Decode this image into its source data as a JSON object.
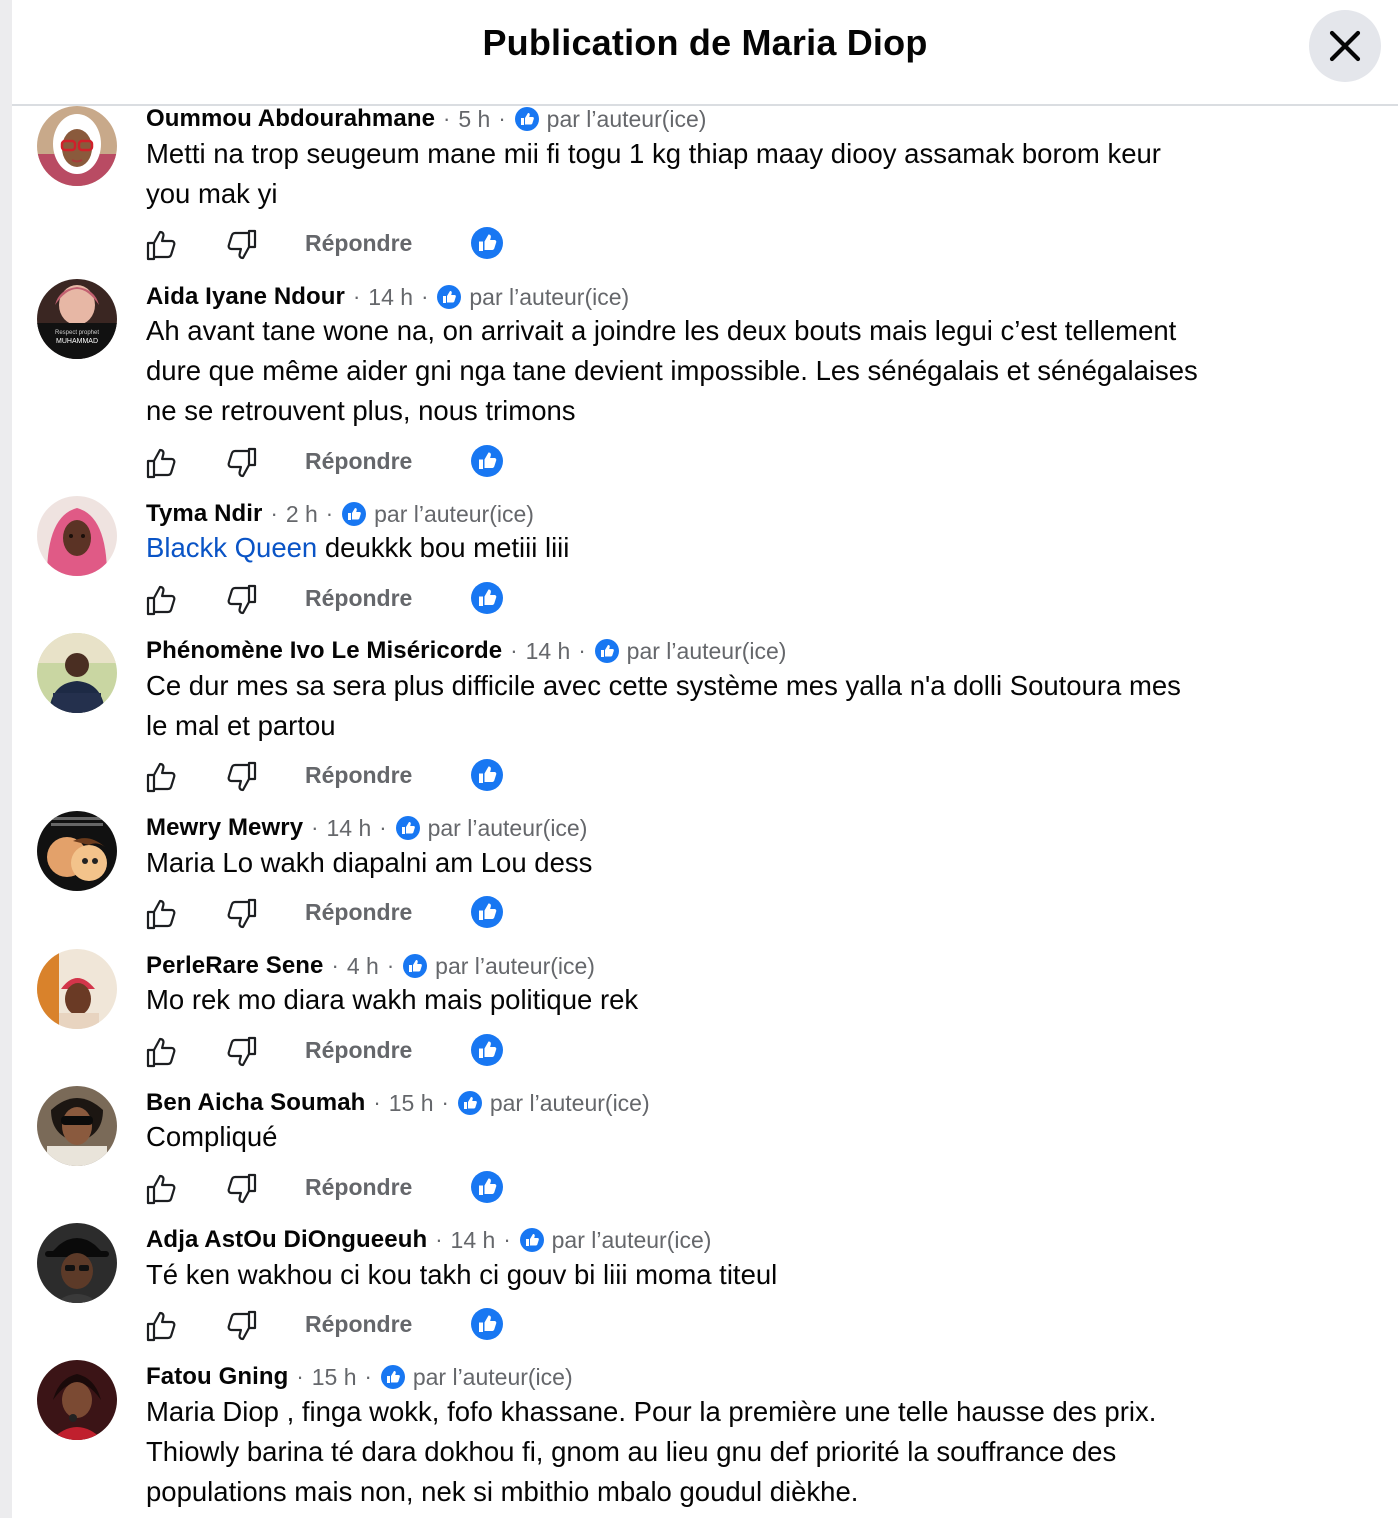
{
  "header": {
    "title": "Publication de Maria Diop"
  },
  "icons": {
    "close": "close-icon",
    "like": "thumbs-up-outline-icon",
    "dislike": "thumbs-down-outline-icon",
    "reaction": "like-reaction-icon",
    "author_badge": "like-badge-icon"
  },
  "colors": {
    "accent": "#1877f2",
    "mention": "#0a54c6",
    "secondary_text": "#65676b",
    "close_bg": "#e4e6eb"
  },
  "comments": [
    {
      "author": "Oummou Abdourahmane",
      "time": "5 h",
      "badge": "par l’auteur(ice)",
      "lines": [
        "Metti na trop seugeum mane mii fi togu 1 kg thiap maay diooy assamak borom keur",
        "you mak yi"
      ],
      "reply": "Répondre"
    },
    {
      "author": "Aida Iyane Ndour",
      "time": "14 h",
      "badge": "par l’auteur(ice)",
      "lines": [
        "Ah avant tane wone na, on arrivait a joindre les deux bouts mais legui c’est tellement",
        "dure que même aider gni nga tane devient impossible. Les sénégalais et sénégalaises",
        "ne se retrouvent plus, nous trimons"
      ],
      "reply": "Répondre",
      "avatar_text": [
        "Respect prophet",
        "MUHAMMAD"
      ]
    },
    {
      "author": "Tyma Ndir",
      "time": "2 h",
      "badge": "par l’auteur(ice)",
      "mention": "Blackk Queen",
      "lines": [
        " deukkk bou metiii liii"
      ],
      "reply": "Répondre"
    },
    {
      "author": "Phénomène Ivo Le Miséricorde",
      "time": "14 h",
      "badge": "par l’auteur(ice)",
      "lines": [
        "Ce dur mes sa sera plus difficile avec cette système mes yalla n'a dolli Soutoura mes",
        "le mal et partou"
      ],
      "reply": "Répondre"
    },
    {
      "author": "Mewry Mewry",
      "time": "14 h",
      "badge": "par l’auteur(ice)",
      "lines": [
        "Maria Lo wakh diapalni am Lou dess"
      ],
      "reply": "Répondre"
    },
    {
      "author": "PerleRare Sene",
      "time": "4 h",
      "badge": "par l’auteur(ice)",
      "lines": [
        "Mo rek mo diara wakh mais politique rek"
      ],
      "reply": "Répondre"
    },
    {
      "author": "Ben Aicha Soumah",
      "time": "15 h",
      "badge": "par l’auteur(ice)",
      "lines": [
        "Compliqué"
      ],
      "reply": "Répondre"
    },
    {
      "author": "Adja AstOu DiOngueeuh",
      "time": "14 h",
      "badge": "par l’auteur(ice)",
      "lines": [
        "Té ken wakhou ci kou takh ci gouv bi liii moma titeul"
      ],
      "reply": "Répondre"
    },
    {
      "author": "Fatou Gning",
      "time": "15 h",
      "badge": "par l’auteur(ice)",
      "lines": [
        "Maria Diop , finga wokk, fofo khassane. Pour la première une telle hausse des prix.",
        "Thiowly barina té dara dokhou fi, gnom au lieu gnu def priorité la souffrance des",
        "populations mais non, nek si mbithio mbalo goudul dièkhe."
      ]
    }
  ]
}
